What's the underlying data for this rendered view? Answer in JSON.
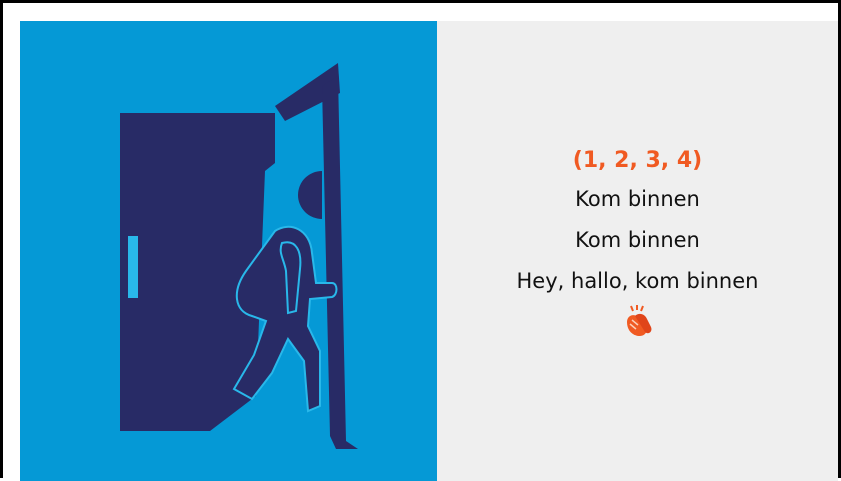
{
  "slide": {
    "illustration_icon": "person-walking-through-door-icon",
    "count_text": "(1, 2, 3, 4)",
    "lines": [
      "Kom binnen",
      "Kom binnen",
      "Hey, hallo, kom binnen"
    ],
    "emoji_icon": "clapping-hands-icon",
    "colors": {
      "left_background": "#0599d6",
      "figure": "#282b66",
      "outline": "#29b8ea",
      "right_background": "#efefef",
      "accent": "#f05a22"
    }
  }
}
